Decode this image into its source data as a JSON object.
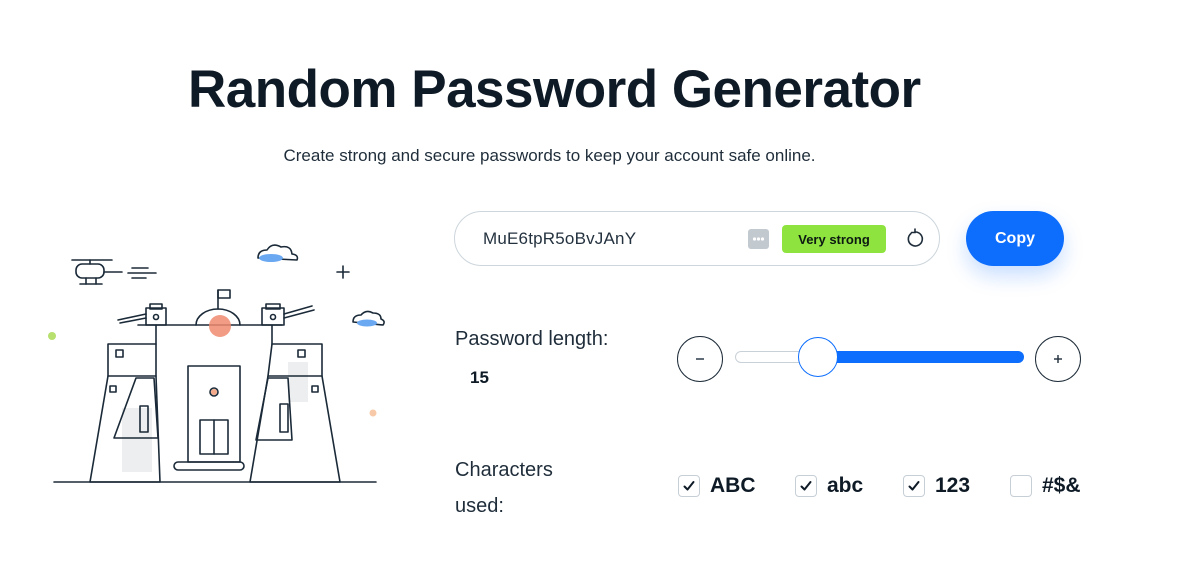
{
  "header": {
    "title": "Random Password Generator",
    "subtitle": "Create strong and secure passwords to keep your account safe online."
  },
  "generator": {
    "password": "MuE6tpR5oBvJAnY",
    "strength": "Very strong",
    "strength_color": "#8fe33f",
    "copy_label": "Copy",
    "accent": "#0d6efd",
    "icons": [
      "dots-icon",
      "refresh-icon",
      "minus-icon",
      "plus-icon",
      "check-icon"
    ]
  },
  "length": {
    "label": "Password length:",
    "value": "15",
    "min": 1,
    "max": 50,
    "current": 15
  },
  "characters": {
    "label": "Characters used:",
    "options": [
      {
        "label": "ABC",
        "checked": true
      },
      {
        "label": "abc",
        "checked": true
      },
      {
        "label": "123",
        "checked": true
      },
      {
        "label": "#$&",
        "checked": false
      }
    ]
  }
}
